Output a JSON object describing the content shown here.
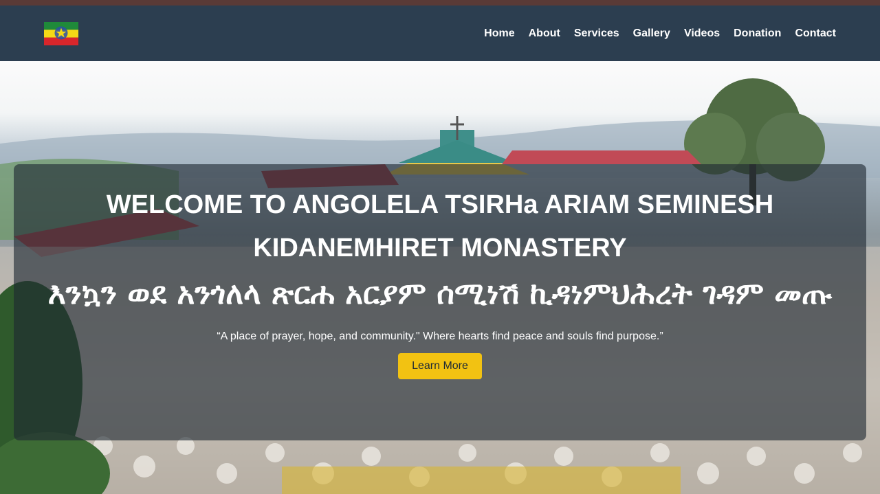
{
  "nav": {
    "logo_alt": "Ethiopian flag emblem",
    "links": [
      "Home",
      "About",
      "Services",
      "Gallery",
      "Videos",
      "Donation",
      "Contact"
    ]
  },
  "hero": {
    "title_en": "WELCOME TO ANGOLELA TSIRHa ARIAM SEMINESH KIDANEMHIRET MONASTERY",
    "title_am": "እንኳን ወደ አንጎለላ ጽርሐ አርያም ሰሚነሽ ኪዳነምህሕረት ገዳም መጡ",
    "tagline": "“A place of prayer, hope, and community.\" Where hearts find peace and souls find purpose.”",
    "cta_label": "Learn More"
  },
  "colors": {
    "navbar_bg": "#2c3e50",
    "top_strip": "#5a3a36",
    "cta_bg": "#f2c212",
    "flag_green": "#1f8a3a",
    "flag_yellow": "#f5d916",
    "flag_red": "#d8262b",
    "emblem_blue": "#2b4fa8"
  }
}
